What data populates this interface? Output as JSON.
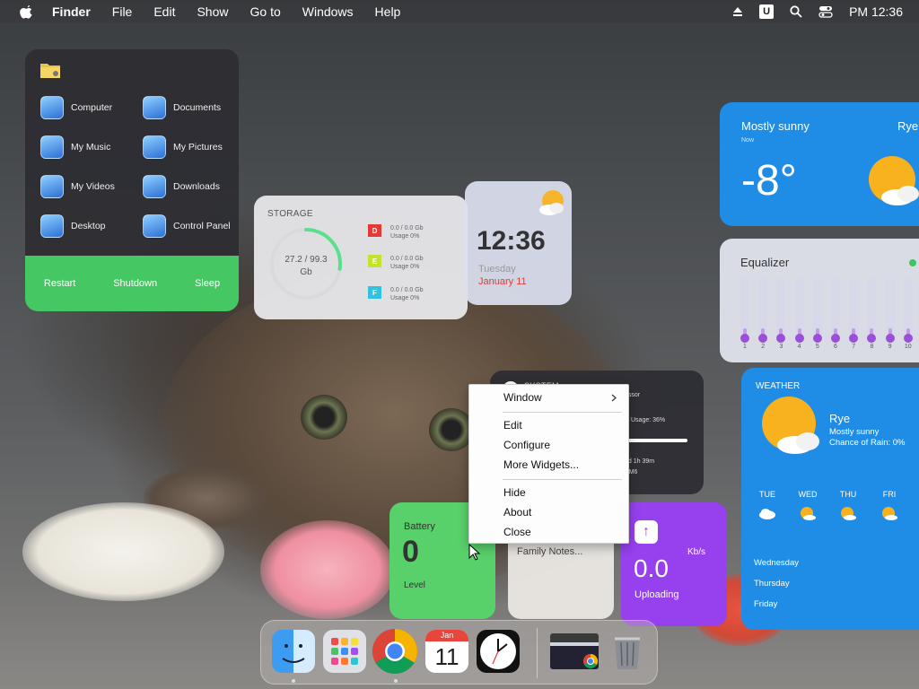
{
  "menubar": {
    "apple_icon": "apple-logo-icon",
    "app_name": "Finder",
    "items": [
      "File",
      "Edit",
      "Show",
      "Go to",
      "Windows",
      "Help"
    ],
    "status": {
      "time": "PM 12:36",
      "u_icon": "U"
    }
  },
  "places": {
    "items": [
      "Computer",
      "Documents",
      "My Music",
      "My Pictures",
      "My Videos",
      "Downloads",
      "Desktop",
      "Control Panel"
    ],
    "actions": [
      "Restart",
      "Shutdown",
      "Sleep"
    ],
    "accent": "#45c764"
  },
  "storage": {
    "title": "STORAGE",
    "usage": "27.2 / 99.3",
    "unit": "Gb",
    "used_fraction": 0.274,
    "drives": [
      {
        "letter": "D",
        "size": "0.0 / 0.0 Gb",
        "usage": "Usage 0%",
        "color": "#e53935"
      },
      {
        "letter": "E",
        "size": "0.0 / 0.0 Gb",
        "usage": "Usage 0%",
        "color": "#c6e22d"
      },
      {
        "letter": "F",
        "size": "0.0 / 0.0 Gb",
        "usage": "Usage 0%",
        "color": "#32c2e0"
      }
    ]
  },
  "clock": {
    "time": "12:36",
    "day": "Tuesday",
    "date": "January 11"
  },
  "weather_top": {
    "condition": "Mostly sunny",
    "location": "Rye",
    "now": "Now",
    "temp": "-8°"
  },
  "equalizer": {
    "title": "Equalizer",
    "bands": [
      "1",
      "2",
      "3",
      "4",
      "5",
      "6",
      "7",
      "8",
      "9",
      "10"
    ]
  },
  "weather_big": {
    "title": "WEATHER",
    "city": "Rye",
    "condition": "Mostly sunny",
    "rain": "Chance of Rain: 0%",
    "forecast": [
      "TUE",
      "WED",
      "THU",
      "FRI"
    ],
    "days": [
      "Wednesday",
      "Thursday",
      "Friday"
    ]
  },
  "system": {
    "title": "SYSTEM",
    "processor": "essor",
    "usage": "U Usage: 36%",
    "usage_fraction": 0.36,
    "uptime": "0d 1h 39m",
    "vm": "VM6"
  },
  "battery": {
    "label": "Battery",
    "value": "0",
    "level": "Level"
  },
  "notes": {
    "label": "Family Notes..."
  },
  "upload": {
    "unit": "Kb/s",
    "value": "0.0",
    "label": "Uploading"
  },
  "context_menu": {
    "window": "Window",
    "edit": "Edit",
    "configure": "Configure",
    "more": "More Widgets...",
    "hide": "Hide",
    "about": "About",
    "close": "Close"
  },
  "dock": {
    "calendar_month": "Jan",
    "calendar_day": "11",
    "apps": [
      "finder-icon",
      "launchpad-icon",
      "chrome-icon",
      "calendar-icon",
      "clock-icon",
      "chrome-window-thumbnail",
      "trash-icon"
    ]
  }
}
